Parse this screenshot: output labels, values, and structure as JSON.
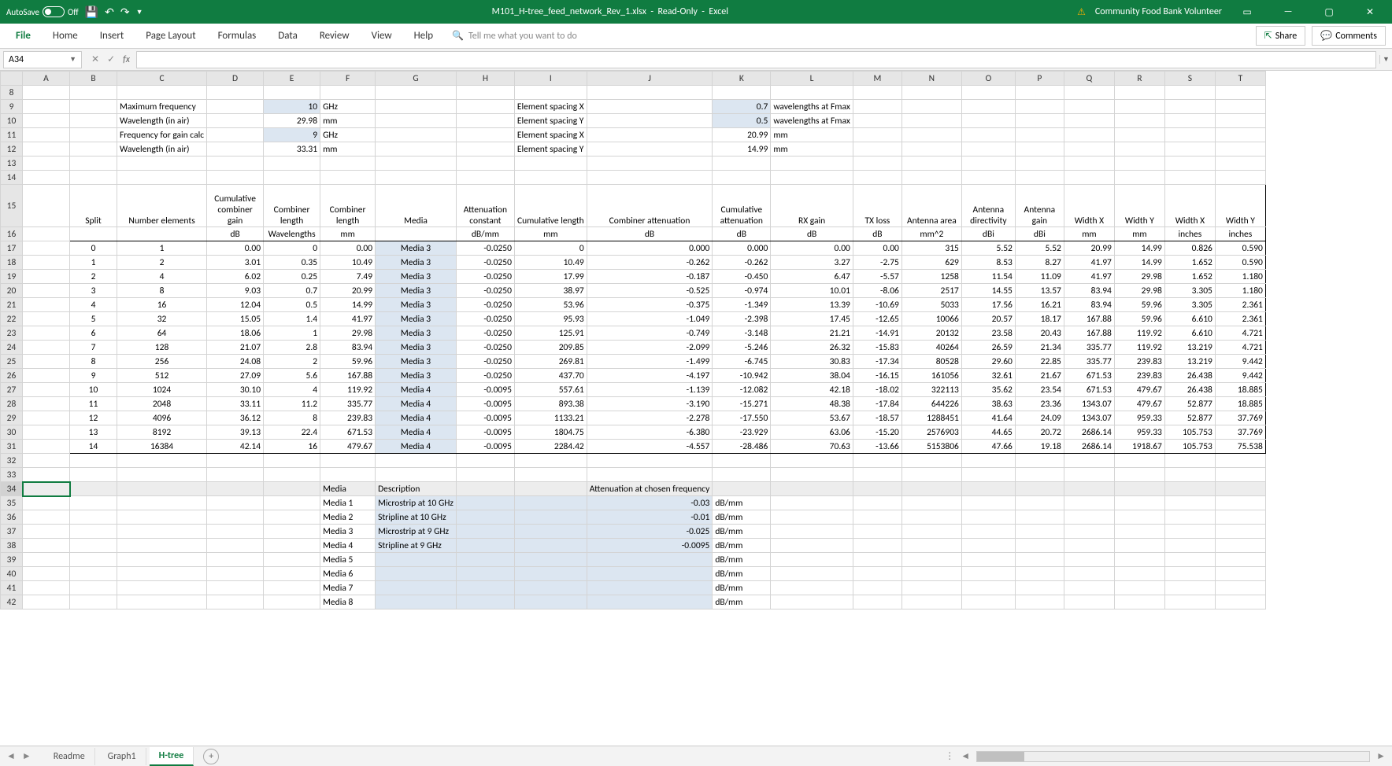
{
  "titlebar": {
    "autosave_label": "AutoSave",
    "autosave_state": "Off",
    "filename": "M101_H-tree_feed_network_Rev_1.xlsx",
    "readonly": "Read-Only",
    "app": "Excel",
    "user": "Community Food Bank Volunteer"
  },
  "ribbon": {
    "tabs": [
      "File",
      "Home",
      "Insert",
      "Page Layout",
      "Formulas",
      "Data",
      "Review",
      "View",
      "Help"
    ],
    "tellme": "Tell me what you want to do",
    "share": "Share",
    "comments": "Comments"
  },
  "namebox": "A34",
  "columns": [
    "A",
    "B",
    "C",
    "D",
    "E",
    "F",
    "G",
    "H",
    "I",
    "J",
    "K",
    "L",
    "M",
    "N",
    "O",
    "P",
    "Q",
    "R",
    "S",
    "T"
  ],
  "params": [
    {
      "row": 9,
      "label": "Maximum frequency",
      "val": "10",
      "unit": "GHz",
      "label2": "Element spacing X",
      "val2": "0.7",
      "unit2": "wavelengths at Fmax",
      "hl1": true,
      "hl2": true
    },
    {
      "row": 10,
      "label": "Wavelength (in air)",
      "val": "29.98",
      "unit": "mm",
      "label2": "Element spacing Y",
      "val2": "0.5",
      "unit2": "wavelengths at Fmax",
      "hl1": false,
      "hl2": true
    },
    {
      "row": 11,
      "label": "Frequency for gain calc",
      "val": "9",
      "unit": "GHz",
      "label2": "Element spacing X",
      "val2": "20.99",
      "unit2": "mm",
      "hl1": true,
      "hl2": false
    },
    {
      "row": 12,
      "label": "Wavelength (in air)",
      "val": "33.31",
      "unit": "mm",
      "label2": "Element spacing Y",
      "val2": "14.99",
      "unit2": "mm",
      "hl1": false,
      "hl2": false
    }
  ],
  "headers1": [
    "",
    "Split",
    "Number elements",
    "Cumulative combiner gain",
    "Combiner length",
    "Combiner length",
    "Media",
    "Attenuation constant",
    "Cumulative length",
    "Combiner attenuation",
    "Cumulative attenuation",
    "RX gain",
    "TX loss",
    "Antenna area",
    "Antenna directivity",
    "Antenna gain",
    "Width X",
    "Width Y",
    "Width X",
    "Width Y"
  ],
  "headers2": [
    "",
    "",
    "",
    "dB",
    "Wavelengths",
    "mm",
    "",
    "dB/mm",
    "mm",
    "dB",
    "dB",
    "dB",
    "dB",
    "mm^2",
    "dBi",
    "dBi",
    "mm",
    "mm",
    "inches",
    "inches"
  ],
  "data": [
    [
      "0",
      "1",
      "0.00",
      "0",
      "0.00",
      "Media 3",
      "-0.0250",
      "0",
      "0.000",
      "0.000",
      "0.00",
      "0.00",
      "315",
      "5.52",
      "5.52",
      "20.99",
      "14.99",
      "0.826",
      "0.590"
    ],
    [
      "1",
      "2",
      "3.01",
      "0.35",
      "10.49",
      "Media 3",
      "-0.0250",
      "10.49",
      "-0.262",
      "-0.262",
      "3.27",
      "-2.75",
      "629",
      "8.53",
      "8.27",
      "41.97",
      "14.99",
      "1.652",
      "0.590"
    ],
    [
      "2",
      "4",
      "6.02",
      "0.25",
      "7.49",
      "Media 3",
      "-0.0250",
      "17.99",
      "-0.187",
      "-0.450",
      "6.47",
      "-5.57",
      "1258",
      "11.54",
      "11.09",
      "41.97",
      "29.98",
      "1.652",
      "1.180"
    ],
    [
      "3",
      "8",
      "9.03",
      "0.7",
      "20.99",
      "Media 3",
      "-0.0250",
      "38.97",
      "-0.525",
      "-0.974",
      "10.01",
      "-8.06",
      "2517",
      "14.55",
      "13.57",
      "83.94",
      "29.98",
      "3.305",
      "1.180"
    ],
    [
      "4",
      "16",
      "12.04",
      "0.5",
      "14.99",
      "Media 3",
      "-0.0250",
      "53.96",
      "-0.375",
      "-1.349",
      "13.39",
      "-10.69",
      "5033",
      "17.56",
      "16.21",
      "83.94",
      "59.96",
      "3.305",
      "2.361"
    ],
    [
      "5",
      "32",
      "15.05",
      "1.4",
      "41.97",
      "Media 3",
      "-0.0250",
      "95.93",
      "-1.049",
      "-2.398",
      "17.45",
      "-12.65",
      "10066",
      "20.57",
      "18.17",
      "167.88",
      "59.96",
      "6.610",
      "2.361"
    ],
    [
      "6",
      "64",
      "18.06",
      "1",
      "29.98",
      "Media 3",
      "-0.0250",
      "125.91",
      "-0.749",
      "-3.148",
      "21.21",
      "-14.91",
      "20132",
      "23.58",
      "20.43",
      "167.88",
      "119.92",
      "6.610",
      "4.721"
    ],
    [
      "7",
      "128",
      "21.07",
      "2.8",
      "83.94",
      "Media 3",
      "-0.0250",
      "209.85",
      "-2.099",
      "-5.246",
      "26.32",
      "-15.83",
      "40264",
      "26.59",
      "21.34",
      "335.77",
      "119.92",
      "13.219",
      "4.721"
    ],
    [
      "8",
      "256",
      "24.08",
      "2",
      "59.96",
      "Media 3",
      "-0.0250",
      "269.81",
      "-1.499",
      "-6.745",
      "30.83",
      "-17.34",
      "80528",
      "29.60",
      "22.85",
      "335.77",
      "239.83",
      "13.219",
      "9.442"
    ],
    [
      "9",
      "512",
      "27.09",
      "5.6",
      "167.88",
      "Media 3",
      "-0.0250",
      "437.70",
      "-4.197",
      "-10.942",
      "38.04",
      "-16.15",
      "161056",
      "32.61",
      "21.67",
      "671.53",
      "239.83",
      "26.438",
      "9.442"
    ],
    [
      "10",
      "1024",
      "30.10",
      "4",
      "119.92",
      "Media 4",
      "-0.0095",
      "557.61",
      "-1.139",
      "-12.082",
      "42.18",
      "-18.02",
      "322113",
      "35.62",
      "23.54",
      "671.53",
      "479.67",
      "26.438",
      "18.885"
    ],
    [
      "11",
      "2048",
      "33.11",
      "11.2",
      "335.77",
      "Media 4",
      "-0.0095",
      "893.38",
      "-3.190",
      "-15.271",
      "48.38",
      "-17.84",
      "644226",
      "38.63",
      "23.36",
      "1343.07",
      "479.67",
      "52.877",
      "18.885"
    ],
    [
      "12",
      "4096",
      "36.12",
      "8",
      "239.83",
      "Media 4",
      "-0.0095",
      "1133.21",
      "-2.278",
      "-17.550",
      "53.67",
      "-18.57",
      "1288451",
      "41.64",
      "24.09",
      "1343.07",
      "959.33",
      "52.877",
      "37.769"
    ],
    [
      "13",
      "8192",
      "39.13",
      "22.4",
      "671.53",
      "Media 4",
      "-0.0095",
      "1804.75",
      "-6.380",
      "-23.929",
      "63.06",
      "-15.20",
      "2576903",
      "44.65",
      "20.72",
      "2686.14",
      "959.33",
      "105.753",
      "37.769"
    ],
    [
      "14",
      "16384",
      "42.14",
      "16",
      "479.67",
      "Media 4",
      "-0.0095",
      "2284.42",
      "-4.557",
      "-28.486",
      "70.63",
      "-13.66",
      "5153806",
      "47.66",
      "19.18",
      "2686.14",
      "1918.67",
      "105.753",
      "75.538"
    ]
  ],
  "media_header": {
    "media": "Media",
    "desc": "Description",
    "atten": "Attenuation at chosen frequency"
  },
  "media": [
    {
      "row": 35,
      "name": "Media 1",
      "desc": "Microstrip at 10 GHz",
      "val": "-0.03",
      "unit": "dB/mm"
    },
    {
      "row": 36,
      "name": "Media 2",
      "desc": "Stripline at 10 GHz",
      "val": "-0.01",
      "unit": "dB/mm"
    },
    {
      "row": 37,
      "name": "Media 3",
      "desc": "Microstrip at 9 GHz",
      "val": "-0.025",
      "unit": "dB/mm"
    },
    {
      "row": 38,
      "name": "Media 4",
      "desc": "Stripline at 9 GHz",
      "val": "-0.0095",
      "unit": "dB/mm"
    },
    {
      "row": 39,
      "name": "Media 5",
      "desc": "",
      "val": "",
      "unit": "dB/mm"
    },
    {
      "row": 40,
      "name": "Media 6",
      "desc": "",
      "val": "",
      "unit": "dB/mm"
    },
    {
      "row": 41,
      "name": "Media 7",
      "desc": "",
      "val": "",
      "unit": "dB/mm"
    },
    {
      "row": 42,
      "name": "Media 8",
      "desc": "",
      "val": "",
      "unit": "dB/mm"
    }
  ],
  "sheets": [
    "Readme",
    "Graph1",
    "H-tree"
  ],
  "chart_data": {
    "type": "table",
    "title": "H-tree feed network calculations",
    "columns": [
      "Split",
      "Number elements",
      "Cumulative combiner gain (dB)",
      "Combiner length (Wavelengths)",
      "Combiner length (mm)",
      "Media",
      "Attenuation constant (dB/mm)",
      "Cumulative length (mm)",
      "Combiner attenuation (dB)",
      "Cumulative attenuation (dB)",
      "RX gain (dB)",
      "TX loss (dB)",
      "Antenna area (mm^2)",
      "Antenna directivity (dBi)",
      "Antenna gain (dBi)",
      "Width X (mm)",
      "Width Y (mm)",
      "Width X (inches)",
      "Width Y (inches)"
    ],
    "rows": [
      [
        0,
        1,
        0.0,
        0,
        0.0,
        "Media 3",
        -0.025,
        0,
        0.0,
        0.0,
        0.0,
        0.0,
        315,
        5.52,
        5.52,
        20.99,
        14.99,
        0.826,
        0.59
      ],
      [
        1,
        2,
        3.01,
        0.35,
        10.49,
        "Media 3",
        -0.025,
        10.49,
        -0.262,
        -0.262,
        3.27,
        -2.75,
        629,
        8.53,
        8.27,
        41.97,
        14.99,
        1.652,
        0.59
      ],
      [
        2,
        4,
        6.02,
        0.25,
        7.49,
        "Media 3",
        -0.025,
        17.99,
        -0.187,
        -0.45,
        6.47,
        -5.57,
        1258,
        11.54,
        11.09,
        41.97,
        29.98,
        1.652,
        1.18
      ],
      [
        3,
        8,
        9.03,
        0.7,
        20.99,
        "Media 3",
        -0.025,
        38.97,
        -0.525,
        -0.974,
        10.01,
        -8.06,
        2517,
        14.55,
        13.57,
        83.94,
        29.98,
        3.305,
        1.18
      ],
      [
        4,
        16,
        12.04,
        0.5,
        14.99,
        "Media 3",
        -0.025,
        53.96,
        -0.375,
        -1.349,
        13.39,
        -10.69,
        5033,
        17.56,
        16.21,
        83.94,
        59.96,
        3.305,
        2.361
      ],
      [
        5,
        32,
        15.05,
        1.4,
        41.97,
        "Media 3",
        -0.025,
        95.93,
        -1.049,
        -2.398,
        17.45,
        -12.65,
        10066,
        20.57,
        18.17,
        167.88,
        59.96,
        6.61,
        2.361
      ],
      [
        6,
        64,
        18.06,
        1,
        29.98,
        "Media 3",
        -0.025,
        125.91,
        -0.749,
        -3.148,
        21.21,
        -14.91,
        20132,
        23.58,
        20.43,
        167.88,
        119.92,
        6.61,
        4.721
      ],
      [
        7,
        128,
        21.07,
        2.8,
        83.94,
        "Media 3",
        -0.025,
        209.85,
        -2.099,
        -5.246,
        26.32,
        -15.83,
        40264,
        26.59,
        21.34,
        335.77,
        119.92,
        13.219,
        4.721
      ],
      [
        8,
        256,
        24.08,
        2,
        59.96,
        "Media 3",
        -0.025,
        269.81,
        -1.499,
        -6.745,
        30.83,
        -17.34,
        80528,
        29.6,
        22.85,
        335.77,
        239.83,
        13.219,
        9.442
      ],
      [
        9,
        512,
        27.09,
        5.6,
        167.88,
        "Media 3",
        -0.025,
        437.7,
        -4.197,
        -10.942,
        38.04,
        -16.15,
        161056,
        32.61,
        21.67,
        671.53,
        239.83,
        26.438,
        9.442
      ],
      [
        10,
        1024,
        30.1,
        4,
        119.92,
        "Media 4",
        -0.0095,
        557.61,
        -1.139,
        -12.082,
        42.18,
        -18.02,
        322113,
        35.62,
        23.54,
        671.53,
        479.67,
        26.438,
        18.885
      ],
      [
        11,
        2048,
        33.11,
        11.2,
        335.77,
        "Media 4",
        -0.0095,
        893.38,
        -3.19,
        -15.271,
        48.38,
        -17.84,
        644226,
        38.63,
        23.36,
        1343.07,
        479.67,
        52.877,
        18.885
      ],
      [
        12,
        4096,
        36.12,
        8,
        239.83,
        "Media 4",
        -0.0095,
        1133.21,
        -2.278,
        -17.55,
        53.67,
        -18.57,
        1288451,
        41.64,
        24.09,
        1343.07,
        959.33,
        52.877,
        37.769
      ],
      [
        13,
        8192,
        39.13,
        22.4,
        671.53,
        "Media 4",
        -0.0095,
        1804.75,
        -6.38,
        -23.929,
        63.06,
        -15.2,
        2576903,
        44.65,
        20.72,
        2686.14,
        959.33,
        105.753,
        37.769
      ],
      [
        14,
        16384,
        42.14,
        16,
        479.67,
        "Media 4",
        -0.0095,
        2284.42,
        -4.557,
        -28.486,
        70.63,
        -13.66,
        5153806,
        47.66,
        19.18,
        2686.14,
        1918.67,
        105.753,
        75.538
      ]
    ]
  }
}
